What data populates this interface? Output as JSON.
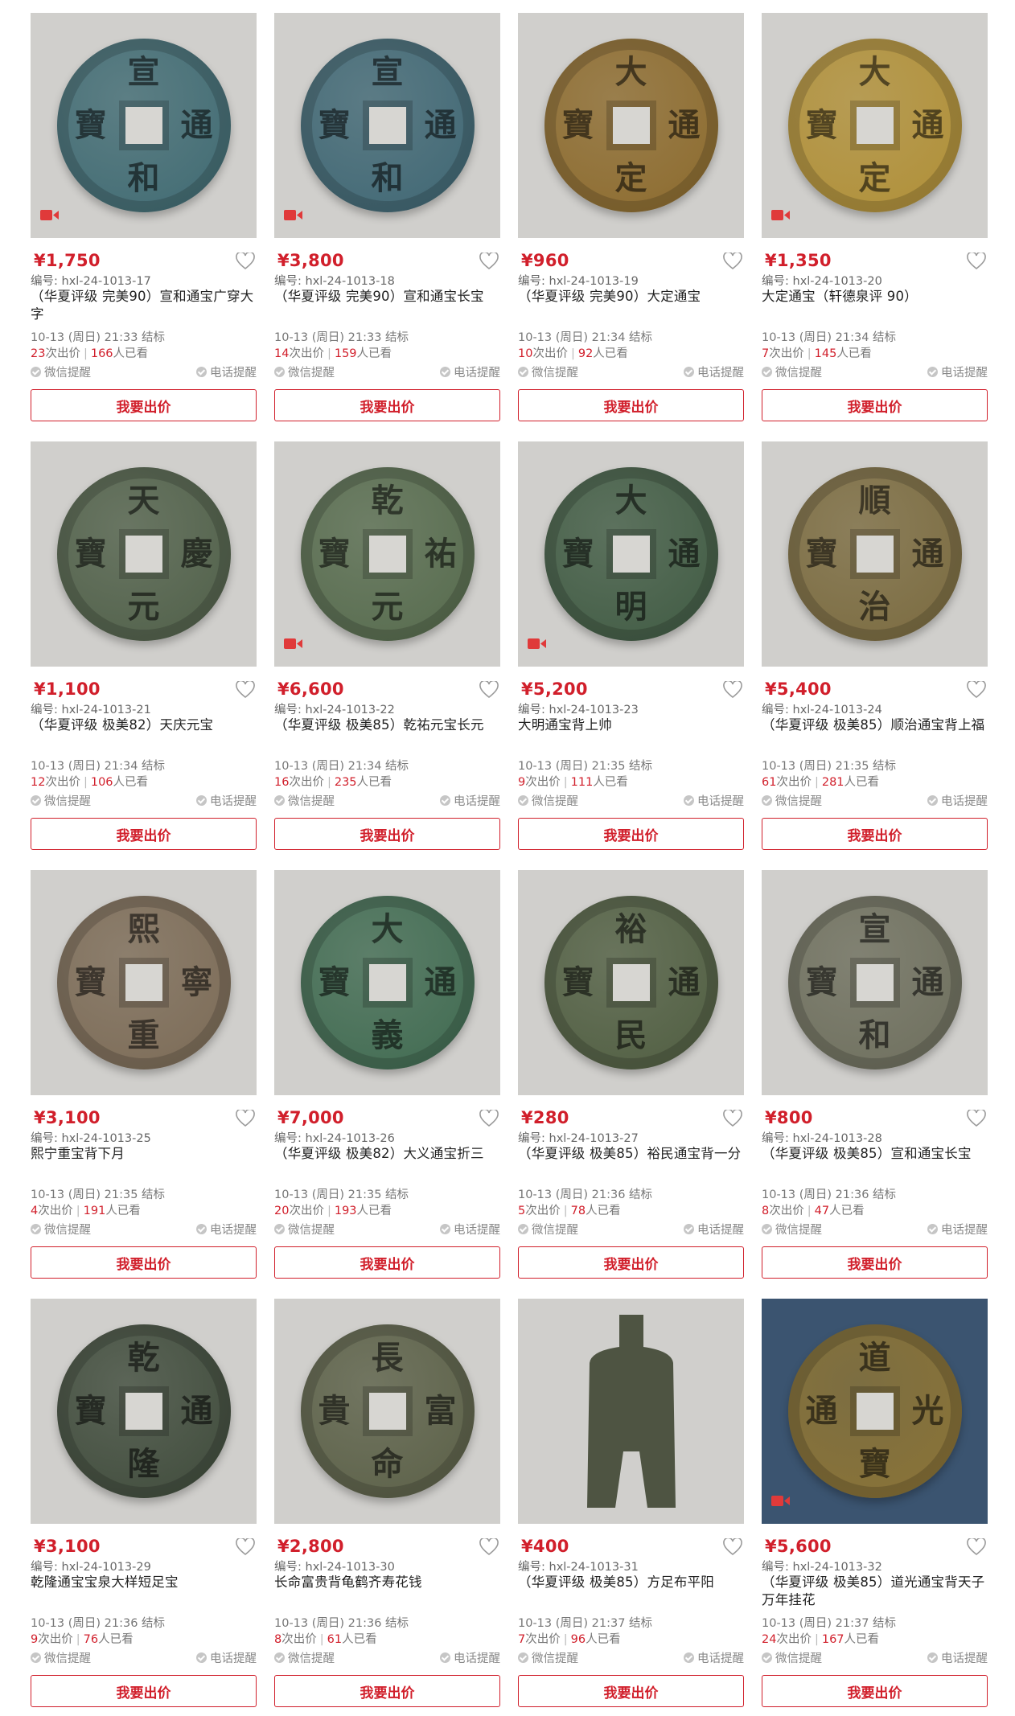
{
  "labels": {
    "code_prefix": "编号: ",
    "bids_suffix": "次出价",
    "views_suffix": "人已看",
    "wechat_reminder": "微信提醒",
    "phone_reminder": "电话提醒",
    "bid_button": "我要出价"
  },
  "colors": {
    "accent": "#d11f2b"
  },
  "items": [
    {
      "price": "¥1,750",
      "code": "hxl-24-1013-17",
      "title": "（华夏评级 完美90）宣和通宝广穿大字",
      "end_time": "10-13 (周日) 21:33 结标",
      "bids": "23",
      "views": "166",
      "video": true,
      "coin_color": "#3f6a72",
      "chars": [
        "宣",
        "和",
        "寶",
        "通"
      ]
    },
    {
      "price": "¥3,800",
      "code": "hxl-24-1013-18",
      "title": "（华夏评级 完美90）宣和通宝长宝",
      "end_time": "10-13 (周日) 21:33 结标",
      "bids": "14",
      "views": "159",
      "video": true,
      "coin_color": "#3e6673",
      "chars": [
        "宣",
        "和",
        "寶",
        "通"
      ]
    },
    {
      "price": "¥960",
      "code": "hxl-24-1013-19",
      "title": "（华夏评级 完美90）大定通宝",
      "end_time": "10-13 (周日) 21:34 结标",
      "bids": "10",
      "views": "92",
      "video": false,
      "coin_color": "#8c6a2c",
      "chars": [
        "大",
        "定",
        "寶",
        "通"
      ]
    },
    {
      "price": "¥1,350",
      "code": "hxl-24-1013-20",
      "title": "大定通宝（轩德泉评 90）",
      "end_time": "10-13 (周日) 21:34 结标",
      "bids": "7",
      "views": "145",
      "video": true,
      "coin_color": "#b08f36",
      "chars": [
        "大",
        "定",
        "寶",
        "通"
      ]
    },
    {
      "price": "¥1,100",
      "code": "hxl-24-1013-21",
      "title": "（华夏评级 极美82）天庆元宝",
      "end_time": "10-13 (周日) 21:34 结标",
      "bids": "12",
      "views": "106",
      "video": false,
      "coin_color": "#4f5f48",
      "chars": [
        "天",
        "元",
        "寶",
        "慶"
      ]
    },
    {
      "price": "¥6,600",
      "code": "hxl-24-1013-22",
      "title": "（华夏评级 极美85）乾祐元宝长元",
      "end_time": "10-13 (周日) 21:34 结标",
      "bids": "16",
      "views": "235",
      "video": true,
      "coin_color": "#556a4c",
      "chars": [
        "乾",
        "元",
        "寶",
        "祐"
      ]
    },
    {
      "price": "¥5,200",
      "code": "hxl-24-1013-23",
      "title": "大明通宝背上帅",
      "end_time": "10-13 (周日) 21:35 结标",
      "bids": "9",
      "views": "111",
      "video": true,
      "coin_color": "#3f5a42",
      "chars": [
        "大",
        "明",
        "寶",
        "通"
      ]
    },
    {
      "price": "¥5,400",
      "code": "hxl-24-1013-24",
      "title": "（华夏评级 极美85）顺治通宝背上福",
      "end_time": "10-13 (周日) 21:35 结标",
      "bids": "61",
      "views": "281",
      "video": false,
      "coin_color": "#7a6a3e",
      "chars": [
        "順",
        "治",
        "寶",
        "通"
      ]
    },
    {
      "price": "¥3,100",
      "code": "hxl-24-1013-25",
      "title": "熙宁重宝背下月",
      "end_time": "10-13 (周日) 21:35 结标",
      "bids": "4",
      "views": "191",
      "video": false,
      "coin_color": "#7b6a55",
      "chars": [
        "熙",
        "重",
        "寶",
        "寧"
      ]
    },
    {
      "price": "¥7,000",
      "code": "hxl-24-1013-26",
      "title": "（华夏评级 极美82）大义通宝折三",
      "end_time": "10-13 (周日) 21:35 结标",
      "bids": "20",
      "views": "193",
      "video": false,
      "coin_color": "#3f6a50",
      "chars": [
        "大",
        "義",
        "寶",
        "通"
      ]
    },
    {
      "price": "¥280",
      "code": "hxl-24-1013-27",
      "title": "（华夏评级 极美85）裕民通宝背一分",
      "end_time": "10-13 (周日) 21:36 结标",
      "bids": "5",
      "views": "78",
      "video": false,
      "coin_color": "#4f5d40",
      "chars": [
        "裕",
        "民",
        "寶",
        "通"
      ]
    },
    {
      "price": "¥800",
      "code": "hxl-24-1013-28",
      "title": "（华夏评级 极美85）宣和通宝长宝",
      "end_time": "10-13 (周日) 21:36 结标",
      "bids": "8",
      "views": "47",
      "video": false,
      "coin_color": "#6d6e5c",
      "chars": [
        "宣",
        "和",
        "寶",
        "通"
      ]
    },
    {
      "price": "¥3,100",
      "code": "hxl-24-1013-29",
      "title": "乾隆通宝宝泉大样短足宝",
      "end_time": "10-13 (周日) 21:36 结标",
      "bids": "9",
      "views": "76",
      "video": false,
      "coin_color": "#3e4a3a",
      "chars": [
        "乾",
        "隆",
        "寶",
        "通"
      ]
    },
    {
      "price": "¥2,800",
      "code": "hxl-24-1013-30",
      "title": "长命富贵背龟鹤齐寿花钱",
      "end_time": "10-13 (周日) 21:36 结标",
      "bids": "8",
      "views": "61",
      "video": false,
      "coin_color": "#5a5f46",
      "chars": [
        "長",
        "命",
        "貴",
        "富"
      ]
    },
    {
      "price": "¥400",
      "code": "hxl-24-1013-31",
      "title": "（华夏评级 极美85）方足布平阳",
      "end_time": "10-13 (周日) 21:37 结标",
      "bids": "7",
      "views": "96",
      "video": false,
      "coin_color": "#4e5442",
      "spade": true
    },
    {
      "price": "¥5,600",
      "code": "hxl-24-1013-32",
      "title": "（华夏评级 极美85）道光通宝背天子万年挂花",
      "end_time": "10-13 (周日) 21:37 结标",
      "bids": "24",
      "views": "167",
      "video": true,
      "coin_color": "#8c7436",
      "chars": [
        "道",
        "寶",
        "通",
        "光"
      ],
      "bg": "#3b5470"
    }
  ]
}
